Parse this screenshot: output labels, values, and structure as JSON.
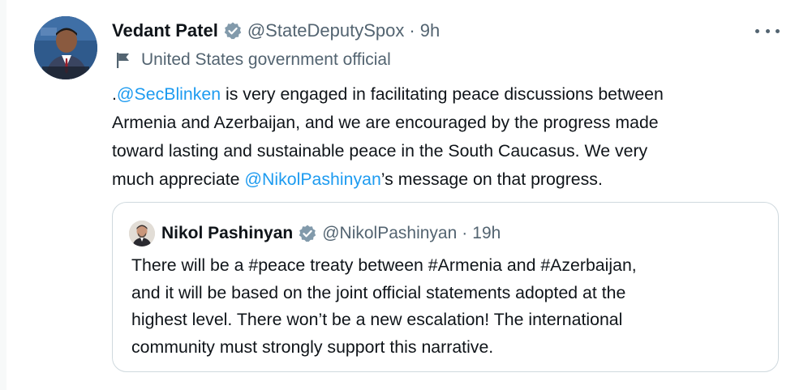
{
  "tweet": {
    "author": {
      "name": "Vedant Patel",
      "handle": "@StateDeputySpox",
      "separator": "·",
      "time": "9h",
      "label": "United States government official"
    },
    "text": {
      "line1_prefix": ".",
      "mention1": "@SecBlinken",
      "line1_rest": " is very engaged in facilitating peace discussions between",
      "line2": "Armenia and Azerbaijan, and we are encouraged by the progress made",
      "line3": "toward lasting and sustainable peace in the South Caucasus. We very",
      "line4_prefix": "much appreciate ",
      "mention2": "@NikolPashinyan",
      "line4_rest": "’s message on that progress."
    }
  },
  "quoted_tweet": {
    "author": {
      "name": "Nikol Pashinyan",
      "handle": "@NikolPashinyan",
      "separator": "·",
      "time": "19h"
    },
    "text_lines": [
      "There will be a #peace treaty between #Armenia and #Azerbaijan,",
      "and it will be based on the joint official statements adopted at the",
      "highest level. There won’t be a new escalation! The international",
      "community must strongly support this narrative."
    ]
  },
  "icons": {
    "verified": "verified-badge-icon",
    "flag": "government-flag-icon",
    "more": "more-options-icon"
  },
  "colors": {
    "badge": "#829aab",
    "mention": "#1d9bf0",
    "secondary_text": "#536471",
    "border": "#cfd9de"
  }
}
